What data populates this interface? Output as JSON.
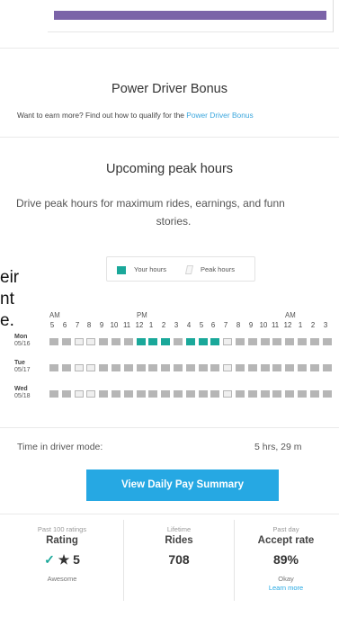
{
  "bonus": {
    "title": "Power Driver Bonus",
    "prompt": "Want to earn more? Find out how to qualify for the ",
    "link_label": "Power Driver Bonus"
  },
  "peak_hours": {
    "title": "Upcoming peak hours",
    "description_line1": "Drive peak hours for maximum rides, earnings, and funn",
    "description_line2": "stories."
  },
  "overlay_text": [
    "eir",
    "nt",
    "e."
  ],
  "legend": {
    "your_hours_label": "Your hours",
    "peak_hours_label": "Peak hours",
    "your_hours_color": "#1aa89a",
    "idle_color": "#b6b6b6"
  },
  "schedule": {
    "period_labels": [
      {
        "label": "AM",
        "hour_index": 0
      },
      {
        "label": "PM",
        "hour_index": 7
      },
      {
        "label": "AM",
        "hour_index": 19
      }
    ],
    "hours": [
      "5",
      "6",
      "7",
      "8",
      "9",
      "10",
      "11",
      "12",
      "1",
      "2",
      "3",
      "4",
      "5",
      "6",
      "7",
      "8",
      "9",
      "10",
      "11",
      "12",
      "1",
      "2",
      "3"
    ],
    "days": [
      {
        "name": "Mon",
        "date": "05/16",
        "your_hours_index": [
          7,
          8,
          9,
          11,
          12,
          13
        ],
        "peak_hours_index": [
          2,
          3,
          14
        ]
      },
      {
        "name": "Tue",
        "date": "05/17",
        "your_hours_index": [],
        "peak_hours_index": [
          2,
          3,
          14
        ]
      },
      {
        "name": "Wed",
        "date": "05/18",
        "your_hours_index": [],
        "peak_hours_index": [
          2,
          3,
          14
        ]
      }
    ]
  },
  "driver_mode": {
    "label": "Time in driver mode:",
    "value": "5 hrs, 29 m"
  },
  "pay_button_label": "View Daily Pay Summary",
  "stats": [
    {
      "caption": "Past 100 ratings",
      "title": "Rating",
      "value": "5",
      "note": "Awesome",
      "icon": "check-icon"
    },
    {
      "caption": "Lifetime",
      "title": "Rides",
      "value": "708"
    },
    {
      "caption": "Past day",
      "title": "Accept rate",
      "value": "89%",
      "note": "Okay",
      "link": "Learn more"
    }
  ]
}
